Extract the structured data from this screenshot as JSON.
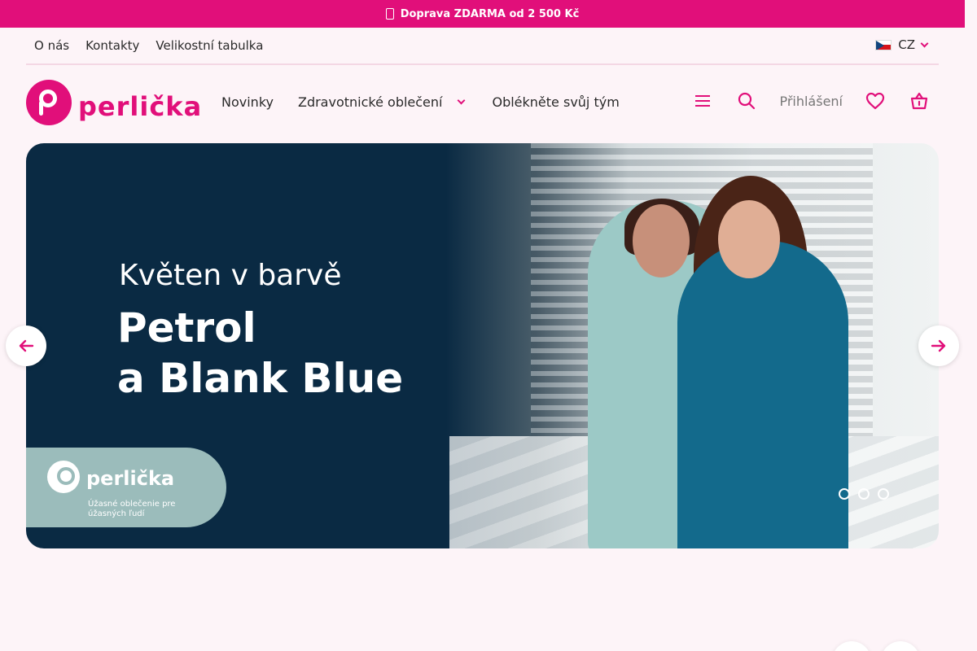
{
  "promo": {
    "text": "Doprava ZDARMA od 2 500 Kč",
    "icon": "truck-icon"
  },
  "top_links": [
    {
      "label": "O nás"
    },
    {
      "label": "Kontakty"
    },
    {
      "label": "Velikostní tabulka"
    }
  ],
  "language": {
    "code": "CZ",
    "flag": "czech-flag-icon"
  },
  "brand": {
    "name": "perlička",
    "color": "#e10f7a"
  },
  "nav": {
    "items": [
      {
        "label": "Novinky"
      },
      {
        "label": "Zdravotnické oblečení"
      },
      {
        "label": "Oblékněte svůj tým"
      }
    ]
  },
  "tools": {
    "menu_icon": "menu-icon",
    "search_icon": "search-icon",
    "login_label": "Přihlášení",
    "wishlist_icon": "heart-icon",
    "cart_icon": "basket-icon"
  },
  "hero": {
    "kicker": "Květen v barvě",
    "title_line1": "Petrol",
    "title_line2": "a Blank Blue",
    "badge_name": "perlička",
    "badge_tagline": "Úžasné oblečenie pre úžasných ľudí",
    "slide_count": 3
  },
  "colors": {
    "accent": "#e10f7a",
    "hero_bg": "#0a2a43",
    "page_bg": "#fdf4f8"
  }
}
